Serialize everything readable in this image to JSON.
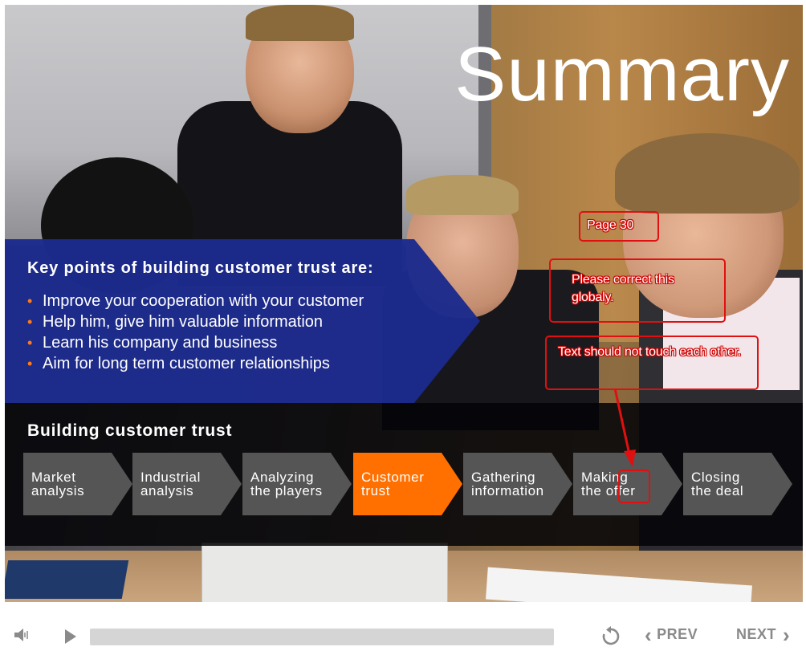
{
  "slide": {
    "title": "Summary",
    "key_points": {
      "heading": "Key points of building customer trust are:",
      "items": [
        "Improve your cooperation with your customer",
        "Help him, give him valuable information",
        "Learn his company and business",
        "Aim for long term customer relationships"
      ],
      "bullet": "•",
      "panel_color": "#1c2a8c",
      "bullet_color": "#ff7a1a"
    },
    "process": {
      "title": "Building customer trust",
      "steps": [
        {
          "label": "Market\nanalysis",
          "active": false
        },
        {
          "label": "Industrial\nanalysis",
          "active": false
        },
        {
          "label": "Analyzing\nthe players",
          "active": false
        },
        {
          "label": "Customer\ntrust",
          "active": true
        },
        {
          "label": "Gathering\ninformation",
          "active": false
        },
        {
          "label": "Making\nthe offer",
          "active": false
        },
        {
          "label": "Closing\nthe deal",
          "active": false
        }
      ],
      "active_color": "#ff7000",
      "inactive_color": "#555555"
    }
  },
  "annotations": {
    "page_note": "Page 30",
    "global_note": "Please correct this globaly.",
    "touch_note": "Text should not touch each other.",
    "color": "#e01010"
  },
  "player": {
    "volume_icon": "speaker-icon",
    "play_icon": "play-icon",
    "replay_icon": "replay-icon",
    "prev_label": "PREV",
    "next_label": "NEXT",
    "prev_chevron": "‹",
    "next_chevron": "›"
  }
}
